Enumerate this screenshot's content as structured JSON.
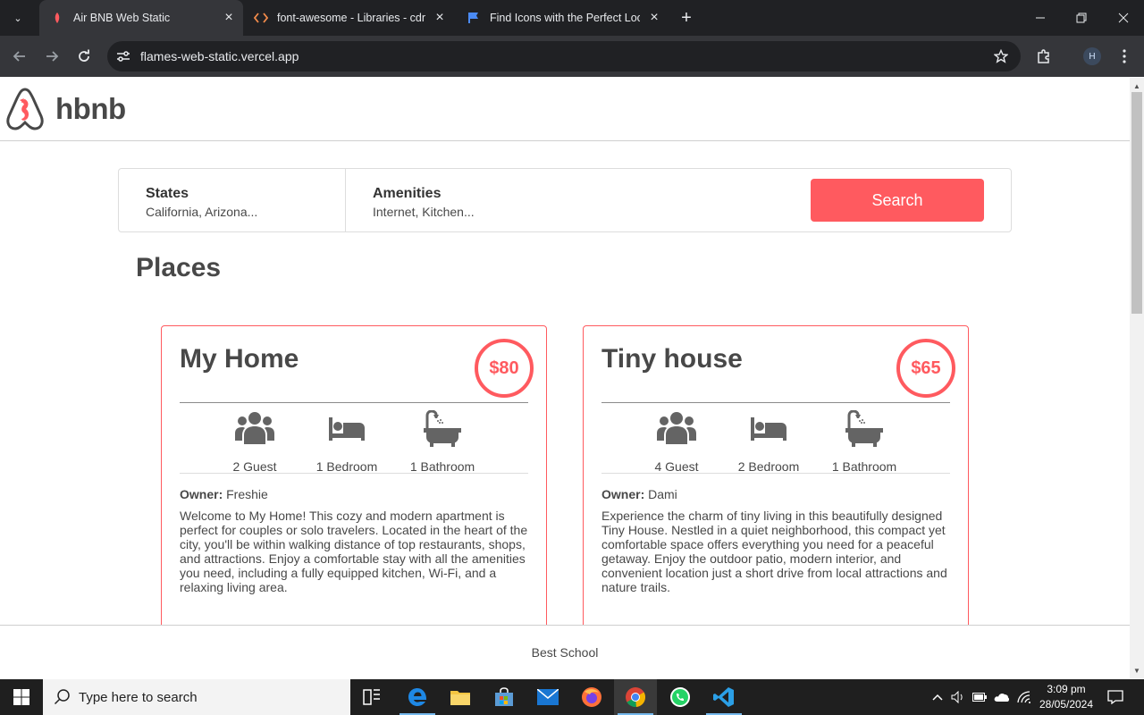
{
  "browser": {
    "tabs": [
      {
        "title": "Air BNB Web Static",
        "icon": "airbnb-favicon",
        "active": true
      },
      {
        "title": "font-awesome - Libraries - cdnjs",
        "icon": "code-icon",
        "active": false
      },
      {
        "title": "Find Icons with the Perfect Look",
        "icon": "flag-icon",
        "active": false
      }
    ],
    "url": "flames-web-static.vercel.app",
    "profile_initial": "H"
  },
  "site": {
    "logo_text": "hbnb",
    "filters": {
      "states_title": "States",
      "states_value": "California, Arizona...",
      "amenities_title": "Amenities",
      "amenities_value": "Internet, Kitchen...",
      "search_label": "Search"
    },
    "places_title": "Places",
    "places": [
      {
        "name": "My Home",
        "price": "$80",
        "guests": "2 Guest",
        "bedrooms": "1 Bedroom",
        "bathrooms": "1 Bathroom",
        "owner_label": "Owner:",
        "owner": "Freshie",
        "description": "Welcome to My Home! This cozy and modern apartment is perfect for couples or solo travelers. Located in the heart of the city, you'll be within walking distance of top restaurants, shops, and attractions. Enjoy a comfortable stay with all the amenities you need, including a fully equipped kitchen, Wi-Fi, and a relaxing living area."
      },
      {
        "name": "Tiny house",
        "price": "$65",
        "guests": "4 Guest",
        "bedrooms": "2 Bedroom",
        "bathrooms": "1 Bathroom",
        "owner_label": "Owner:",
        "owner": "Dami",
        "description": "Experience the charm of tiny living in this beautifully designed Tiny House. Nestled in a quiet neighborhood, this compact yet comfortable space offers everything you need for a peaceful getaway. Enjoy the outdoor patio, modern interior, and convenient location just a short drive from local attractions and nature trails."
      }
    ],
    "footer": "Best School"
  },
  "taskbar": {
    "search_placeholder": "Type here to search",
    "time": "3:09 pm",
    "date": "28/05/2024",
    "apps": [
      "task-view",
      "edge",
      "file-explorer",
      "microsoft-store",
      "mail",
      "firefox",
      "chrome",
      "whatsapp",
      "vscode"
    ]
  },
  "colors": {
    "accent": "#ff5a5f",
    "text": "#484848",
    "chrome_dark": "#202124",
    "chrome_toolbar": "#35363a"
  }
}
